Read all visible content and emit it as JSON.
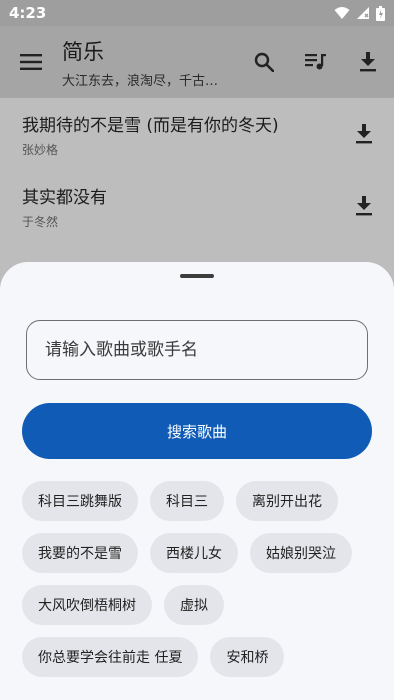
{
  "status": {
    "time": "4:23"
  },
  "app": {
    "title": "简乐",
    "subtitle": "大江东去，浪淘尽，千古风流人物"
  },
  "songs": [
    {
      "title": "我期待的不是雪 (而是有你的冬天)",
      "artist": "张妙格"
    },
    {
      "title": "其实都没有",
      "artist": "于冬然"
    }
  ],
  "sheet": {
    "placeholder": "请输入歌曲或歌手名",
    "search_label": "搜索歌曲",
    "chips": [
      "科目三跳舞版",
      "科目三",
      "离别开出花",
      "我要的不是雪",
      "西楼儿女",
      "姑娘别哭泣",
      "大风吹倒梧桐树",
      "虚拟",
      "你总要学会往前走  任夏",
      "安和桥"
    ]
  },
  "colors": {
    "accent": "#0f5bb5",
    "chip_bg": "#e3e5ea",
    "sheet_bg": "#f6f7fb"
  }
}
